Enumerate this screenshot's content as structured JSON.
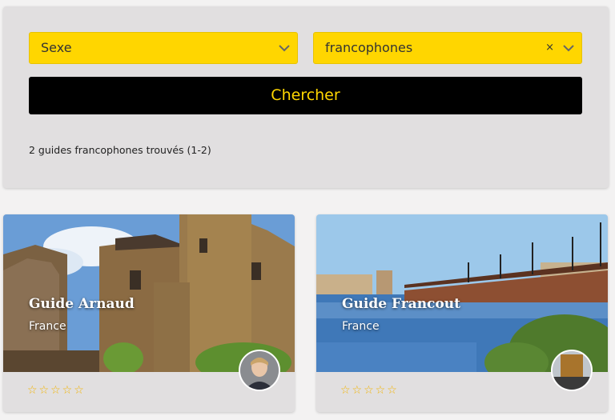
{
  "filters": {
    "sexe": {
      "value": "Sexe"
    },
    "language": {
      "value": "francophones",
      "clear_label": "×"
    },
    "search_button": "Chercher"
  },
  "results_text": "2 guides francophones trouvés (1-2)",
  "guides": [
    {
      "name": "Guide Arnaud",
      "country": "France",
      "rating": 0,
      "stars": "☆☆☆☆☆"
    },
    {
      "name": "Guide Francout",
      "country": "France",
      "rating": 0,
      "stars": "☆☆☆☆☆"
    }
  ],
  "colors": {
    "accent": "#ffd600",
    "button_bg": "#000000",
    "star": "#f3b400"
  }
}
